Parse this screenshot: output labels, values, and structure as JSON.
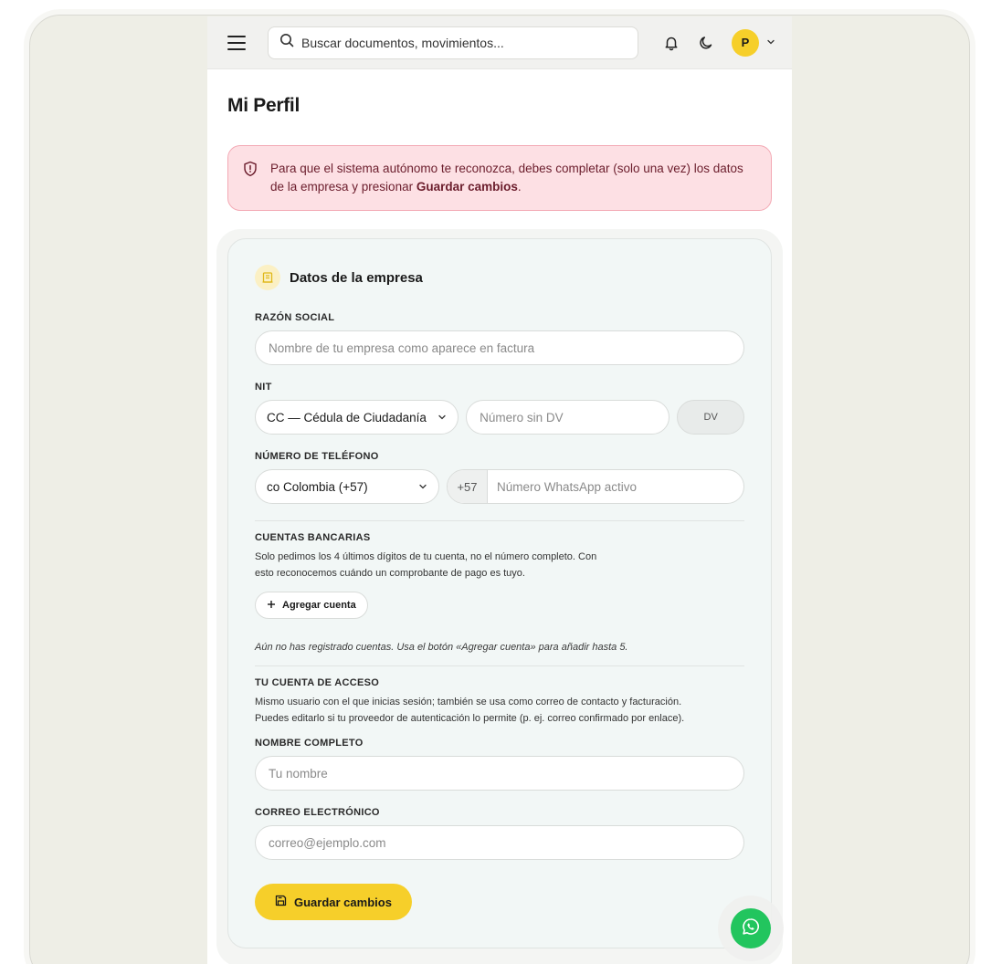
{
  "topbar": {
    "search_placeholder": "Buscar documentos, movimientos...",
    "avatar_initial": "P"
  },
  "page": {
    "title": "Mi Perfil"
  },
  "alert": {
    "text_before": "Para que el sistema autónomo te reconozca, debes completar (solo una vez) los datos de la empresa y presionar ",
    "text_bold": "Guardar cambios",
    "text_after": "."
  },
  "company": {
    "title": "Datos de la empresa",
    "razon_social_label": "RAZÓN SOCIAL",
    "razon_social_placeholder": "Nombre de tu empresa como aparece en factura",
    "nit_label": "NIT",
    "doc_type_value": "CC — Cédula de Ciudadanía",
    "nit_placeholder": "Número sin DV",
    "dv_placeholder": "DV",
    "phone_label": "NÚMERO DE TELÉFONO",
    "country_value": "co Colombia (+57)",
    "phone_prefix": "+57",
    "phone_placeholder": "Número WhatsApp activo"
  },
  "bank": {
    "title": "CUENTAS BANCARIAS",
    "help_line1": "Solo pedimos los 4 últimos dígitos de tu cuenta, no el número completo. Con",
    "help_line2": "esto reconocemos cuándo un comprobante de pago es tuyo.",
    "add_label": "Agregar cuenta",
    "empty_note": "Aún no has registrado cuentas. Usa el botón «Agregar cuenta» para añadir hasta 5."
  },
  "access": {
    "title": "TU CUENTA DE ACCESO",
    "help_line1": "Mismo usuario con el que inicias sesión; también se usa como correo de contacto y facturación.",
    "help_line2": "Puedes editarlo si tu proveedor de autenticación lo permite (p. ej. correo confirmado por enlace).",
    "name_label": "NOMBRE COMPLETO",
    "name_placeholder": "Tu nombre",
    "email_label": "CORREO ELECTRÓNICO",
    "email_placeholder": "correo@ejemplo.com"
  },
  "actions": {
    "save_label": "Guardar cambios"
  },
  "colors": {
    "accent": "#f6cf2a",
    "alert_bg": "#fde0e4",
    "whatsapp": "#22c55e"
  }
}
